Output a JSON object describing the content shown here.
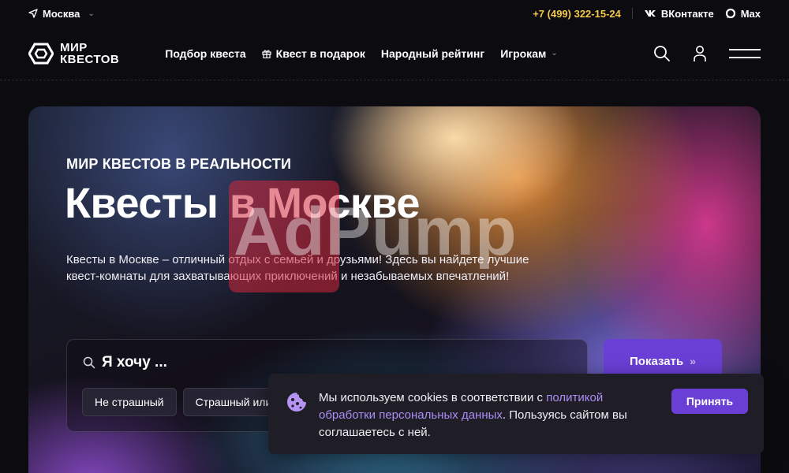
{
  "topbar": {
    "city": "Москва",
    "phone": "+7 (499) 322-15-24",
    "vk_label": "ВКонтакте",
    "max_label": "Max"
  },
  "header": {
    "logo_line1": "МИР",
    "logo_line2": "КВЕСТОВ",
    "nav": [
      {
        "label": "Подбор квеста"
      },
      {
        "label": "Квест в подарок"
      },
      {
        "label": "Народный рейтинг"
      },
      {
        "label": "Игрокам"
      }
    ]
  },
  "hero": {
    "eyebrow": "МИР КВЕСТОВ В РЕАЛЬНОСТИ",
    "title": "Квесты в Москве",
    "description": "Квесты в Москве – отличный отдых с семьей и друзьями! Здесь вы найдете лучшие квест-комнаты для захватывающих приключений и незабываемых впечатлений!",
    "watermark": "AdPump"
  },
  "search": {
    "label": "Я хочу ...",
    "chips": [
      "Не страшный",
      "Страшный или"
    ],
    "show_button": "Показать"
  },
  "cookie": {
    "text_before": "Мы используем cookies в соответствии с ",
    "link_text": "политикой обработки персональных данных",
    "text_after": ". Пользуясь сайтом вы соглашаетесь с ней.",
    "accept_button": "Принять"
  },
  "colors": {
    "accent": "#6a3fd6",
    "phone": "#f2c94c",
    "link": "#a98ef5",
    "background": "#0c0b10"
  }
}
